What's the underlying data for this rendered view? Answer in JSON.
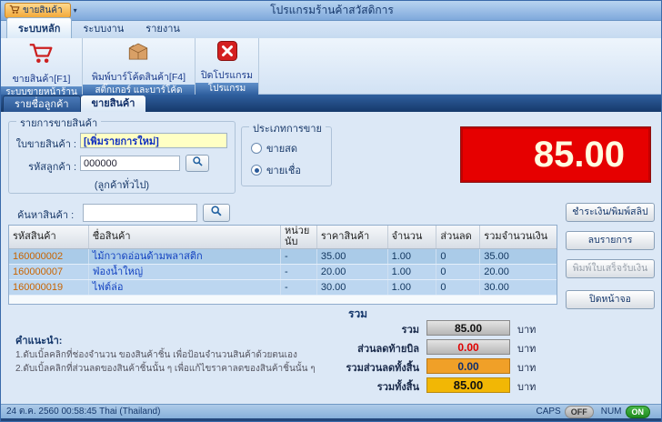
{
  "window": {
    "title": "โปรแกรมร้านค้าสวัสดิการ",
    "quick_access_label": "ขายสินค้า"
  },
  "icons": {
    "chevron_down": "▾"
  },
  "ribbon": {
    "tabs": [
      {
        "label": "ระบบหลัก"
      },
      {
        "label": "ระบบงาน"
      },
      {
        "label": "รายงาน"
      }
    ],
    "groups": [
      {
        "item_label": "ขายสินค้า[F1]",
        "icon": "cart-icon",
        "caption": "ระบบขายหน้าร้าน"
      },
      {
        "item_label": "พิมพ์บาร์โค้ดสินค้า[F4]",
        "icon": "box-icon",
        "caption": "สติ๊กเกอร์ และบาร์โค้ด"
      },
      {
        "item_label": "ปิดโปรแกรม",
        "icon": "close-icon",
        "caption": "โปรแกรม"
      }
    ]
  },
  "doc_tabs": [
    {
      "label": "รายชื่อลูกค้า"
    },
    {
      "label": "ขายสินค้า"
    }
  ],
  "sale_header": {
    "group_title": "รายการขายสินค้า",
    "invoice_label": "ใบขายสินค้า :",
    "invoice_value": "[เพิ่มรายการใหม่]",
    "customer_label": "รหัสลูกค้า :",
    "customer_code": "000000",
    "customer_note": "(ลูกค้าทั่วไป)",
    "sale_type_title": "ประเภทการขาย",
    "sale_type_options": [
      {
        "label": "ขายสด",
        "selected": false
      },
      {
        "label": "ขายเชื่อ",
        "selected": true
      }
    ],
    "total_display": "85.00"
  },
  "search": {
    "label": "ค้นหาสินค้า :",
    "value": ""
  },
  "items_table": {
    "headers": [
      "รหัสสินค้า",
      "ชื่อสินค้า",
      "หน่วยนับ",
      "ราคาสินค้า",
      "จำนวน",
      "ส่วนลด",
      "รวมจำนวนเงิน"
    ],
    "rows": [
      {
        "code": "160000002",
        "name": "ไม้กวาดอ่อนด้ามพลาสติก",
        "unit": "-",
        "price": "35.00",
        "qty": "1.00",
        "discount": "0",
        "amount": "35.00"
      },
      {
        "code": "160000007",
        "name": "ฟ่องน้ำใหญ่",
        "unit": "-",
        "price": "20.00",
        "qty": "1.00",
        "discount": "0",
        "amount": "20.00"
      },
      {
        "code": "160000019",
        "name": "ไฟต์ล่อ",
        "unit": "-",
        "price": "30.00",
        "qty": "1.00",
        "discount": "0",
        "amount": "30.00"
      }
    ]
  },
  "actions": {
    "pay_print": "ชำระเงิน/พิมพ์สลิป",
    "delete_item": "ลบรายการ",
    "print_receipt": "พิมพ์ใบเสร็จรับเงิน",
    "close_screen": "ปิดหน้าจอ"
  },
  "summary": {
    "header": "รวม",
    "rows": [
      {
        "label": "รวม",
        "value": "85.00",
        "unit": "บาท"
      },
      {
        "label": "ส่วนลดท้ายบิล",
        "value": "0.00",
        "unit": "บาท"
      },
      {
        "label": "รวมส่วนลดทั้งสิ้น",
        "value": "0.00",
        "unit": "บาท"
      },
      {
        "label": "รวมทั้งสิ้น",
        "value": "85.00",
        "unit": "บาท"
      }
    ]
  },
  "tips": {
    "title": "คำแนะนำ:",
    "lines": [
      "1.ดับเบิ้ลคลิกที่ช่องจำนวน ของสินค้าชิ้น เพื่อป้อนจำนวนสินค้าด้วยตนเอง",
      "2.ดับเบิ้ลคลิกที่ส่วนลดของสินค้าชิ้นนั้น ๆ เพื่อแก้ไขราคาลดของสินค้าชิ้นนั้น ๆ"
    ]
  },
  "statusbar": {
    "datetime": "24 ต.ค. 2560  00:58:45 Thai (Thailand)",
    "caps_label": "CAPS",
    "caps_state": "OFF",
    "num_label": "NUM",
    "num_state": "ON"
  },
  "colors": {
    "display_red": "#e60000",
    "summary_orange": "#f0a028",
    "summary_amber": "#f2b705",
    "num_on_green": "#2da02d"
  }
}
